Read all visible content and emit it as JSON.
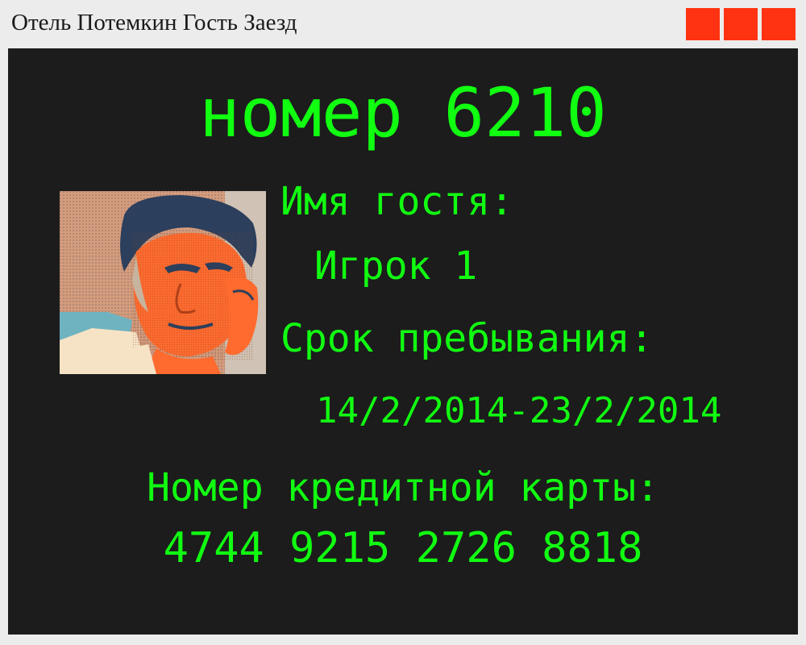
{
  "window": {
    "title": "Отель Потемкин Гость Заезд",
    "control_color": "#ff3311"
  },
  "checkin": {
    "room": "номер 6210",
    "guest_label": "Имя гостя:",
    "guest_name": "Игрок 1",
    "stay_label": "Срок пребывания:",
    "stay_dates": "14/2/2014-23/2/2014",
    "card_label": "Номер кредитной карты:",
    "card_number": "4744 9215 2726 8818",
    "photo": "guest-portrait-icon"
  },
  "colors": {
    "screen_bg": "#1c1c1c",
    "text": "#11ff11",
    "titlebar_bg": "#ececec"
  }
}
